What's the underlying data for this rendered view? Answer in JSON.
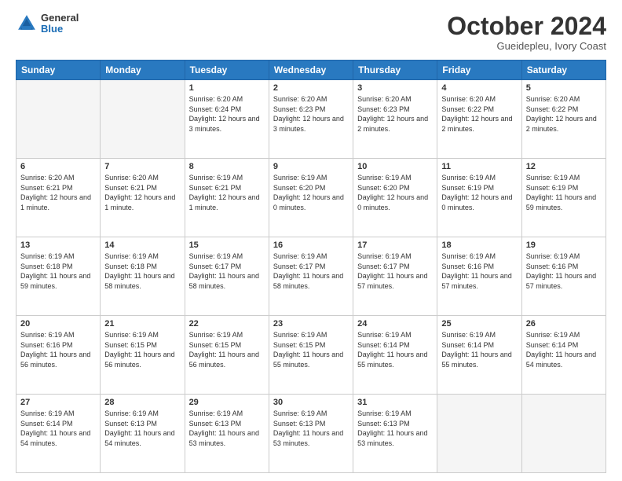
{
  "logo": {
    "general": "General",
    "blue": "Blue"
  },
  "header": {
    "title": "October 2024",
    "location": "Gueidepleu, Ivory Coast"
  },
  "days_of_week": [
    "Sunday",
    "Monday",
    "Tuesday",
    "Wednesday",
    "Thursday",
    "Friday",
    "Saturday"
  ],
  "weeks": [
    [
      {
        "day": "",
        "empty": true
      },
      {
        "day": "",
        "empty": true
      },
      {
        "day": "1",
        "sunrise": "6:20 AM",
        "sunset": "6:24 PM",
        "daylight": "12 hours and 3 minutes."
      },
      {
        "day": "2",
        "sunrise": "6:20 AM",
        "sunset": "6:23 PM",
        "daylight": "12 hours and 3 minutes."
      },
      {
        "day": "3",
        "sunrise": "6:20 AM",
        "sunset": "6:23 PM",
        "daylight": "12 hours and 2 minutes."
      },
      {
        "day": "4",
        "sunrise": "6:20 AM",
        "sunset": "6:22 PM",
        "daylight": "12 hours and 2 minutes."
      },
      {
        "day": "5",
        "sunrise": "6:20 AM",
        "sunset": "6:22 PM",
        "daylight": "12 hours and 2 minutes."
      }
    ],
    [
      {
        "day": "6",
        "sunrise": "6:20 AM",
        "sunset": "6:21 PM",
        "daylight": "12 hours and 1 minute."
      },
      {
        "day": "7",
        "sunrise": "6:20 AM",
        "sunset": "6:21 PM",
        "daylight": "12 hours and 1 minute."
      },
      {
        "day": "8",
        "sunrise": "6:19 AM",
        "sunset": "6:21 PM",
        "daylight": "12 hours and 1 minute."
      },
      {
        "day": "9",
        "sunrise": "6:19 AM",
        "sunset": "6:20 PM",
        "daylight": "12 hours and 0 minutes."
      },
      {
        "day": "10",
        "sunrise": "6:19 AM",
        "sunset": "6:20 PM",
        "daylight": "12 hours and 0 minutes."
      },
      {
        "day": "11",
        "sunrise": "6:19 AM",
        "sunset": "6:19 PM",
        "daylight": "12 hours and 0 minutes."
      },
      {
        "day": "12",
        "sunrise": "6:19 AM",
        "sunset": "6:19 PM",
        "daylight": "11 hours and 59 minutes."
      }
    ],
    [
      {
        "day": "13",
        "sunrise": "6:19 AM",
        "sunset": "6:18 PM",
        "daylight": "11 hours and 59 minutes."
      },
      {
        "day": "14",
        "sunrise": "6:19 AM",
        "sunset": "6:18 PM",
        "daylight": "11 hours and 58 minutes."
      },
      {
        "day": "15",
        "sunrise": "6:19 AM",
        "sunset": "6:17 PM",
        "daylight": "11 hours and 58 minutes."
      },
      {
        "day": "16",
        "sunrise": "6:19 AM",
        "sunset": "6:17 PM",
        "daylight": "11 hours and 58 minutes."
      },
      {
        "day": "17",
        "sunrise": "6:19 AM",
        "sunset": "6:17 PM",
        "daylight": "11 hours and 57 minutes."
      },
      {
        "day": "18",
        "sunrise": "6:19 AM",
        "sunset": "6:16 PM",
        "daylight": "11 hours and 57 minutes."
      },
      {
        "day": "19",
        "sunrise": "6:19 AM",
        "sunset": "6:16 PM",
        "daylight": "11 hours and 57 minutes."
      }
    ],
    [
      {
        "day": "20",
        "sunrise": "6:19 AM",
        "sunset": "6:16 PM",
        "daylight": "11 hours and 56 minutes."
      },
      {
        "day": "21",
        "sunrise": "6:19 AM",
        "sunset": "6:15 PM",
        "daylight": "11 hours and 56 minutes."
      },
      {
        "day": "22",
        "sunrise": "6:19 AM",
        "sunset": "6:15 PM",
        "daylight": "11 hours and 56 minutes."
      },
      {
        "day": "23",
        "sunrise": "6:19 AM",
        "sunset": "6:15 PM",
        "daylight": "11 hours and 55 minutes."
      },
      {
        "day": "24",
        "sunrise": "6:19 AM",
        "sunset": "6:14 PM",
        "daylight": "11 hours and 55 minutes."
      },
      {
        "day": "25",
        "sunrise": "6:19 AM",
        "sunset": "6:14 PM",
        "daylight": "11 hours and 55 minutes."
      },
      {
        "day": "26",
        "sunrise": "6:19 AM",
        "sunset": "6:14 PM",
        "daylight": "11 hours and 54 minutes."
      }
    ],
    [
      {
        "day": "27",
        "sunrise": "6:19 AM",
        "sunset": "6:14 PM",
        "daylight": "11 hours and 54 minutes."
      },
      {
        "day": "28",
        "sunrise": "6:19 AM",
        "sunset": "6:13 PM",
        "daylight": "11 hours and 54 minutes."
      },
      {
        "day": "29",
        "sunrise": "6:19 AM",
        "sunset": "6:13 PM",
        "daylight": "11 hours and 53 minutes."
      },
      {
        "day": "30",
        "sunrise": "6:19 AM",
        "sunset": "6:13 PM",
        "daylight": "11 hours and 53 minutes."
      },
      {
        "day": "31",
        "sunrise": "6:19 AM",
        "sunset": "6:13 PM",
        "daylight": "11 hours and 53 minutes."
      },
      {
        "day": "",
        "empty": true
      },
      {
        "day": "",
        "empty": true
      }
    ]
  ]
}
